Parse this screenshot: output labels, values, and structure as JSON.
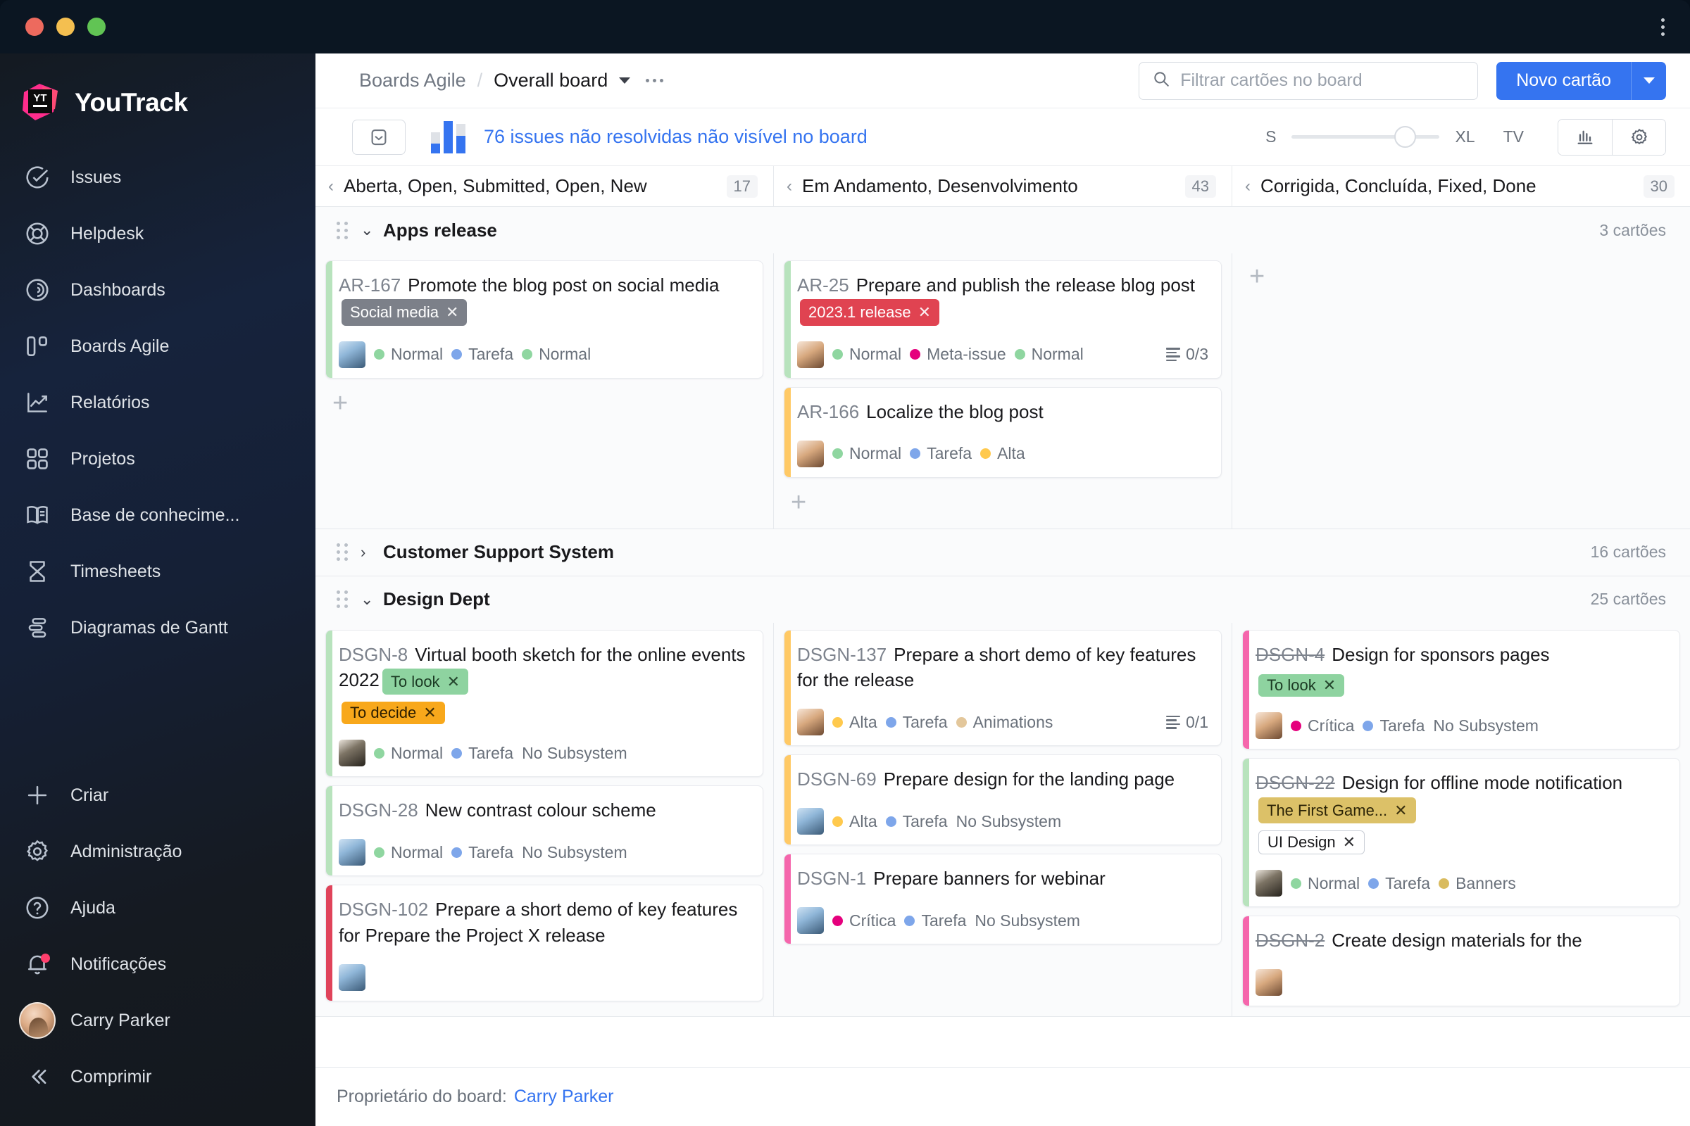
{
  "window": {
    "menu_icon": "kebab-menu-icon"
  },
  "sidebar": {
    "brand": "YouTrack",
    "items": [
      {
        "label": "Issues",
        "icon": "check-circle-icon"
      },
      {
        "label": "Helpdesk",
        "icon": "lifebuoy-icon"
      },
      {
        "label": "Dashboards",
        "icon": "radar-icon"
      },
      {
        "label": "Boards Agile",
        "icon": "board-columns-icon"
      },
      {
        "label": "Relatórios",
        "icon": "chart-line-icon"
      },
      {
        "label": "Projetos",
        "icon": "grid-squares-icon"
      },
      {
        "label": "Base de conhecime...",
        "icon": "book-icon"
      },
      {
        "label": "Timesheets",
        "icon": "hourglass-icon"
      },
      {
        "label": "Diagramas de Gantt",
        "icon": "gantt-icon"
      }
    ],
    "bottom_items": [
      {
        "label": "Criar",
        "icon": "plus-icon"
      },
      {
        "label": "Administração",
        "icon": "gear-icon"
      },
      {
        "label": "Ajuda",
        "icon": "question-circle-icon"
      },
      {
        "label": "Notificações",
        "icon": "bell-icon",
        "badge": true
      },
      {
        "label": "Carry Parker",
        "icon": "avatar"
      },
      {
        "label": "Comprimir",
        "icon": "chevrons-left-icon"
      }
    ]
  },
  "header": {
    "breadcrumb_parent": "Boards Agile",
    "breadcrumb_sep": "/",
    "breadcrumb_current": "Overall board",
    "more_icon": "ellipsis-icon",
    "search_placeholder": "Filtrar cartões no board",
    "search_value": "",
    "search_icon": "search-icon",
    "new_card_label": "Novo cartão"
  },
  "toolbar": {
    "inbox_icon": "inbox-arrow-icon",
    "chart_icon": "bar-chart-icon",
    "unresolved_text": "76 issues não resolvidas não visível no board",
    "size_min": "S",
    "size_max": "XL",
    "tv_label": "TV",
    "chart_button_icon": "chart-bars-icon",
    "settings_button_icon": "gear-icon"
  },
  "columns": [
    {
      "title": "Aberta, Open, Submitted, Open, New",
      "count": "17"
    },
    {
      "title": "Em Andamento, Desenvolvimento",
      "count": "43"
    },
    {
      "title": "Corrigida, Concluída, Fixed, Done",
      "count": "30"
    }
  ],
  "swimlanes": [
    {
      "title": "Apps release",
      "count": "3 cartões",
      "collapsed": false,
      "columns": [
        {
          "cards": [
            {
              "id": "AR-167",
              "resolved": false,
              "title": "Promote the blog post on social media",
              "accent": "#b8e3bd",
              "inline_tag": {
                "label": "Social media",
                "bg": "#7c8089",
                "fg": "#ffffff"
              },
              "avatar": "av-a",
              "fields": [
                {
                  "label": "Normal",
                  "color": "#8fd6a0"
                },
                {
                  "label": "Tarefa",
                  "color": "#7ea6ea"
                },
                {
                  "label": "Normal",
                  "color": "#8fd6a0"
                }
              ]
            }
          ],
          "add_card": "+"
        },
        {
          "cards": [
            {
              "id": "AR-25",
              "resolved": false,
              "title": "Prepare and publish the release blog post",
              "accent": "#b8e3bd",
              "inline_tag": {
                "label": "2023.1 release",
                "bg": "#e04351",
                "fg": "#ffffff"
              },
              "avatar": "av-b",
              "fields": [
                {
                  "label": "Normal",
                  "color": "#8fd6a0"
                },
                {
                  "label": "Meta-issue",
                  "color": "#e5007d"
                },
                {
                  "label": "Normal",
                  "color": "#8fd6a0"
                }
              ],
              "subtasks": "0/3"
            },
            {
              "id": "AR-166",
              "resolved": false,
              "title": "Localize the blog post",
              "accent": "#ffc965",
              "avatar": "av-b",
              "fields": [
                {
                  "label": "Normal",
                  "color": "#8fd6a0"
                },
                {
                  "label": "Tarefa",
                  "color": "#7ea6ea"
                },
                {
                  "label": "Alta",
                  "color": "#ffc94d"
                }
              ]
            }
          ],
          "add_card": "+"
        },
        {
          "cards": [],
          "add_card": "+"
        }
      ]
    },
    {
      "title": "Customer Support System",
      "count": "16 cartões",
      "collapsed": true,
      "columns": []
    },
    {
      "title": "Design Dept",
      "count": "25 cartões",
      "collapsed": false,
      "columns": [
        {
          "cards": [
            {
              "id": "DSGN-8",
              "resolved": false,
              "title": "Virtual booth sketch for the online events 2022",
              "accent": "#b8e3bd",
              "inline_tag": {
                "label": "To look",
                "bg": "#8ed3a0",
                "fg": "#1b3a23"
              },
              "block_tags": [
                {
                  "label": "To decide",
                  "bg": "#f8a81b",
                  "fg": "#2b1d00"
                }
              ],
              "avatar": "av-c",
              "fields": [
                {
                  "label": "Normal",
                  "color": "#8fd6a0"
                },
                {
                  "label": "Tarefa",
                  "color": "#7ea6ea"
                },
                {
                  "label": "No Subsystem",
                  "color": null
                }
              ]
            },
            {
              "id": "DSGN-28",
              "resolved": false,
              "title": "New contrast colour scheme",
              "accent": "#b8e3bd",
              "avatar": "av-a",
              "fields": [
                {
                  "label": "Normal",
                  "color": "#8fd6a0"
                },
                {
                  "label": "Tarefa",
                  "color": "#7ea6ea"
                },
                {
                  "label": "No Subsystem",
                  "color": null
                }
              ]
            },
            {
              "id": "DSGN-102",
              "resolved": false,
              "title": "Prepare a short demo of key features for Prepare the Project X release",
              "accent": "#e0435a",
              "avatar": "av-a",
              "fields": []
            }
          ]
        },
        {
          "cards": [
            {
              "id": "DSGN-137",
              "resolved": false,
              "title": "Prepare a short demo of key features for the release",
              "accent": "#ffc965",
              "avatar": "av-b",
              "fields": [
                {
                  "label": "Alta",
                  "color": "#ffc94d"
                },
                {
                  "label": "Tarefa",
                  "color": "#7ea6ea"
                },
                {
                  "label": "Animations",
                  "color": "#e3c79b"
                }
              ],
              "subtasks": "0/1"
            },
            {
              "id": "DSGN-69",
              "resolved": false,
              "title": "Prepare design for the landing page",
              "accent": "#ffc965",
              "avatar": "av-a",
              "fields": [
                {
                  "label": "Alta",
                  "color": "#ffc94d"
                },
                {
                  "label": "Tarefa",
                  "color": "#7ea6ea"
                },
                {
                  "label": "No Subsystem",
                  "color": null
                }
              ]
            },
            {
              "id": "DSGN-1",
              "resolved": false,
              "title": "Prepare banners for webinar",
              "accent": "#f566ac",
              "avatar": "av-a",
              "fields": [
                {
                  "label": "Crítica",
                  "color": "#e5007d"
                },
                {
                  "label": "Tarefa",
                  "color": "#7ea6ea"
                },
                {
                  "label": "No Subsystem",
                  "color": null
                }
              ]
            }
          ]
        },
        {
          "cards": [
            {
              "id": "DSGN-4",
              "resolved": true,
              "title": "Design for sponsors pages",
              "accent": "#f566ac",
              "block_tags": [
                {
                  "label": "To look",
                  "bg": "#8ed3a0",
                  "fg": "#1b3a23"
                }
              ],
              "avatar": "av-b",
              "fields": [
                {
                  "label": "Crítica",
                  "color": "#e5007d"
                },
                {
                  "label": "Tarefa",
                  "color": "#7ea6ea"
                },
                {
                  "label": "No Subsystem",
                  "color": null
                }
              ]
            },
            {
              "id": "DSGN-22",
              "resolved": true,
              "title": "Design for offline mode notification",
              "accent": "#b8e3bd",
              "inline_tag": {
                "label": "The First Game...",
                "bg": "#dcc168",
                "fg": "#2c2407"
              },
              "block_tags": [
                {
                  "label": "UI Design",
                  "bg": "#ffffff",
                  "fg": "#19191c",
                  "border": "#c9ced6"
                }
              ],
              "avatar": "av-c",
              "fields": [
                {
                  "label": "Normal",
                  "color": "#8fd6a0"
                },
                {
                  "label": "Tarefa",
                  "color": "#7ea6ea"
                },
                {
                  "label": "Banners",
                  "color": "#d9bb5e"
                }
              ]
            },
            {
              "id": "DSGN-2",
              "resolved": true,
              "title": "Create design materials for the",
              "accent": "#f566ac",
              "avatar": "av-b",
              "fields": []
            }
          ]
        }
      ]
    }
  ],
  "footer": {
    "owner_label": "Proprietário do board:",
    "owner_name": "Carry Parker"
  }
}
